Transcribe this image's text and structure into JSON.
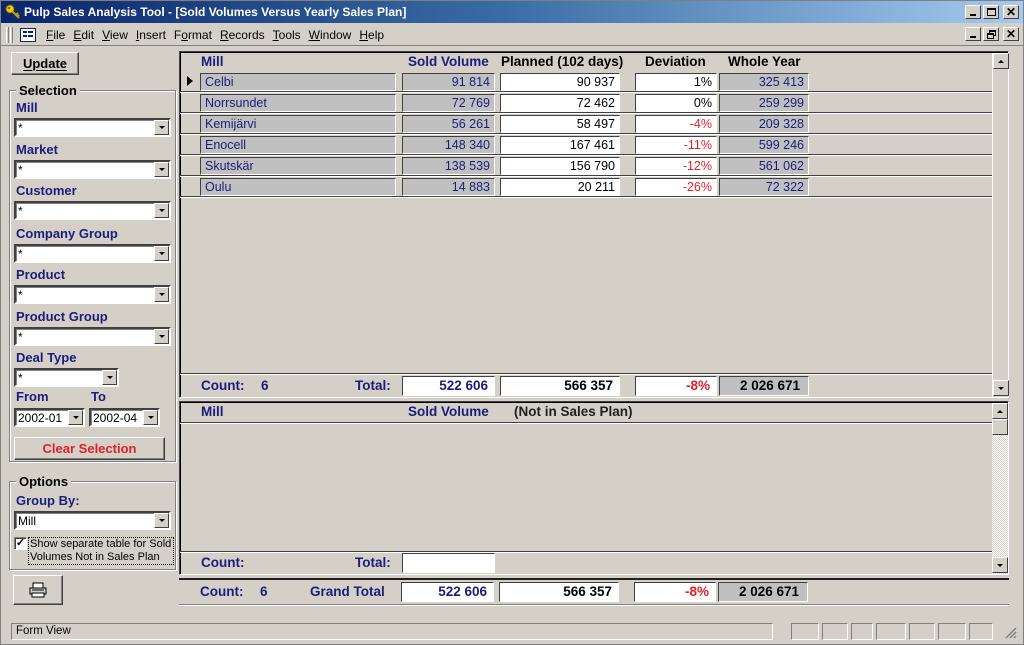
{
  "window": {
    "title": "Pulp Sales Analysis Tool - [Sold Volumes Versus Yearly Sales Plan]",
    "buttons": {
      "minimize": "_",
      "maximize": "□",
      "close": "×",
      "restore": "🗗"
    }
  },
  "menu": [
    {
      "label": "File",
      "accel": "F"
    },
    {
      "label": "Edit",
      "accel": "E"
    },
    {
      "label": "View",
      "accel": "V"
    },
    {
      "label": "Insert",
      "accel": "I"
    },
    {
      "label": "Format",
      "accel": "o"
    },
    {
      "label": "Records",
      "accel": "R"
    },
    {
      "label": "Tools",
      "accel": "T"
    },
    {
      "label": "Window",
      "accel": "W"
    },
    {
      "label": "Help",
      "accel": "H"
    }
  ],
  "sidebar": {
    "update_label": "Update",
    "selection_title": "Selection",
    "fields": [
      {
        "label": "Mill",
        "value": "*"
      },
      {
        "label": "Market",
        "value": "*"
      },
      {
        "label": "Customer",
        "value": "*"
      },
      {
        "label": "Company Group",
        "value": "*"
      },
      {
        "label": "Product",
        "value": "*"
      },
      {
        "label": "Product Group",
        "value": "*"
      },
      {
        "label": "Deal Type",
        "value": "*"
      }
    ],
    "from_label": "From",
    "to_label": "To",
    "from_value": "2002-01",
    "to_value": "2002-04",
    "clear_label": "Clear Selection",
    "options_title": "Options",
    "group_by_label": "Group By:",
    "group_by_value": "Mill",
    "separate_table_checked": true,
    "separate_table_label": "Show separate table for Sold Volumes Not in Sales Plan",
    "print_icon": "printer-icon"
  },
  "main_table": {
    "headers": {
      "mill": "Mill",
      "sold": "Sold Volume",
      "planned": "Planned (102 days)",
      "deviation": "Deviation",
      "whole_year": "Whole Year"
    },
    "rows": [
      {
        "mill": "Celbi",
        "sold": "91 814",
        "planned": "90 937",
        "deviation": "1%",
        "whole_year": "325 413",
        "negative": false,
        "current": true
      },
      {
        "mill": "Norrsundet",
        "sold": "72 769",
        "planned": "72 462",
        "deviation": "0%",
        "whole_year": "259 299",
        "negative": false,
        "current": false
      },
      {
        "mill": "Kemijärvi",
        "sold": "56 261",
        "planned": "58 497",
        "deviation": "-4%",
        "whole_year": "209 328",
        "negative": true,
        "current": false
      },
      {
        "mill": "Enocell",
        "sold": "148 340",
        "planned": "167 461",
        "deviation": "-11%",
        "whole_year": "599 246",
        "negative": true,
        "current": false
      },
      {
        "mill": "Skutskär",
        "sold": "138 539",
        "planned": "156 790",
        "deviation": "-12%",
        "whole_year": "561 062",
        "negative": true,
        "current": false
      },
      {
        "mill": "Oulu",
        "sold": "14 883",
        "planned": "20 211",
        "deviation": "-26%",
        "whole_year": "72 322",
        "negative": true,
        "current": false
      }
    ],
    "footer": {
      "count_label": "Count:",
      "count": "6",
      "total_label": "Total:",
      "sold": "522 606",
      "planned": "566 357",
      "deviation": "-8%",
      "whole_year": "2 026 671"
    }
  },
  "not_in_plan_table": {
    "headers": {
      "mill": "Mill",
      "sold": "Sold Volume",
      "note": "(Not in Sales Plan)"
    },
    "rows": [],
    "footer": {
      "count_label": "Count:",
      "count": "",
      "total_label": "Total:",
      "sold": ""
    }
  },
  "grand_total": {
    "count_label": "Count:",
    "count": "6",
    "label": "Grand Total",
    "sold": "522 606",
    "planned": "566 357",
    "deviation": "-8%",
    "whole_year": "2 026 671"
  },
  "statusbar": {
    "text": "Form View"
  },
  "colors": {
    "label_blue": "#1c1c7a",
    "negative_red": "#e0202a",
    "title_start": "#0a246a",
    "title_end": "#a6caf0"
  }
}
